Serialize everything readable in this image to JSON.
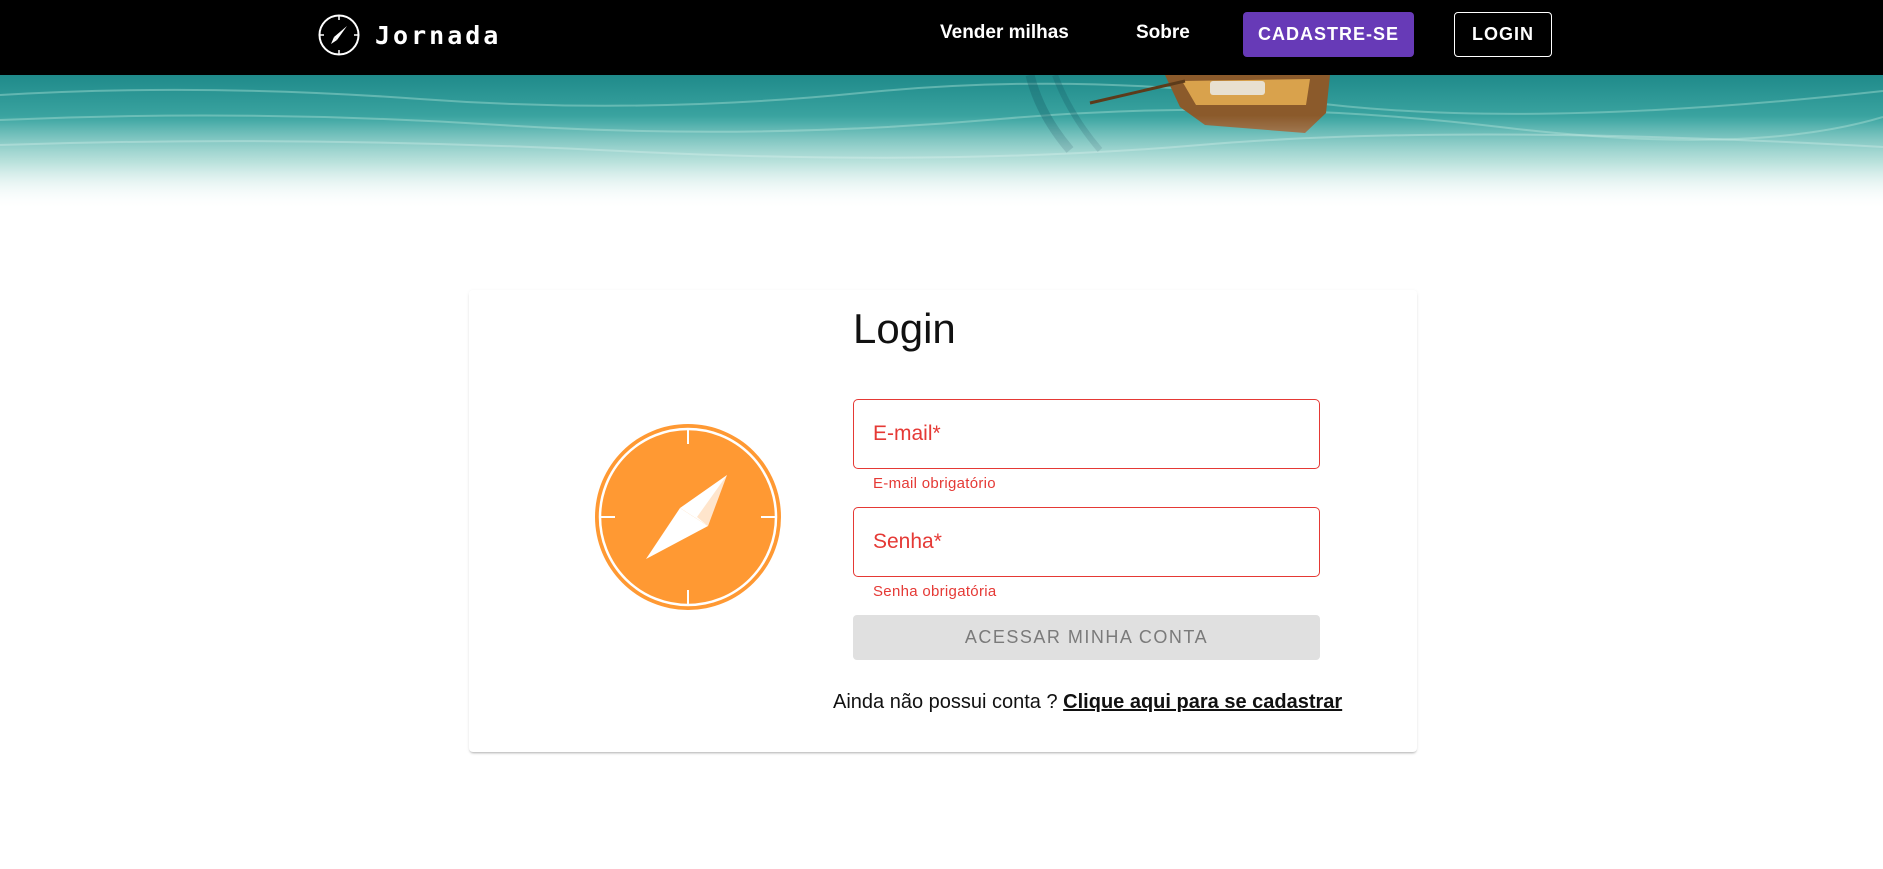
{
  "header": {
    "brand": "Jornada",
    "nav": {
      "sell_miles": "Vender milhas",
      "about": "Sobre"
    },
    "signup_button": "CADASTRE-SE",
    "login_button": "LOGIN",
    "signup_color": "#673ab7"
  },
  "login": {
    "title": "Login",
    "email": {
      "placeholder": "E-mail*",
      "value": "",
      "error": "E-mail obrigatório"
    },
    "password": {
      "placeholder": "Senha*",
      "value": "",
      "error": "Senha obrigatória"
    },
    "submit_button": "ACESSAR MINHA CONTA",
    "signup_prompt": "Ainda não possui conta ?",
    "signup_link": "Clique aqui para se cadastrar",
    "error_color": "#e53935",
    "logo_color": "#ff9933"
  }
}
